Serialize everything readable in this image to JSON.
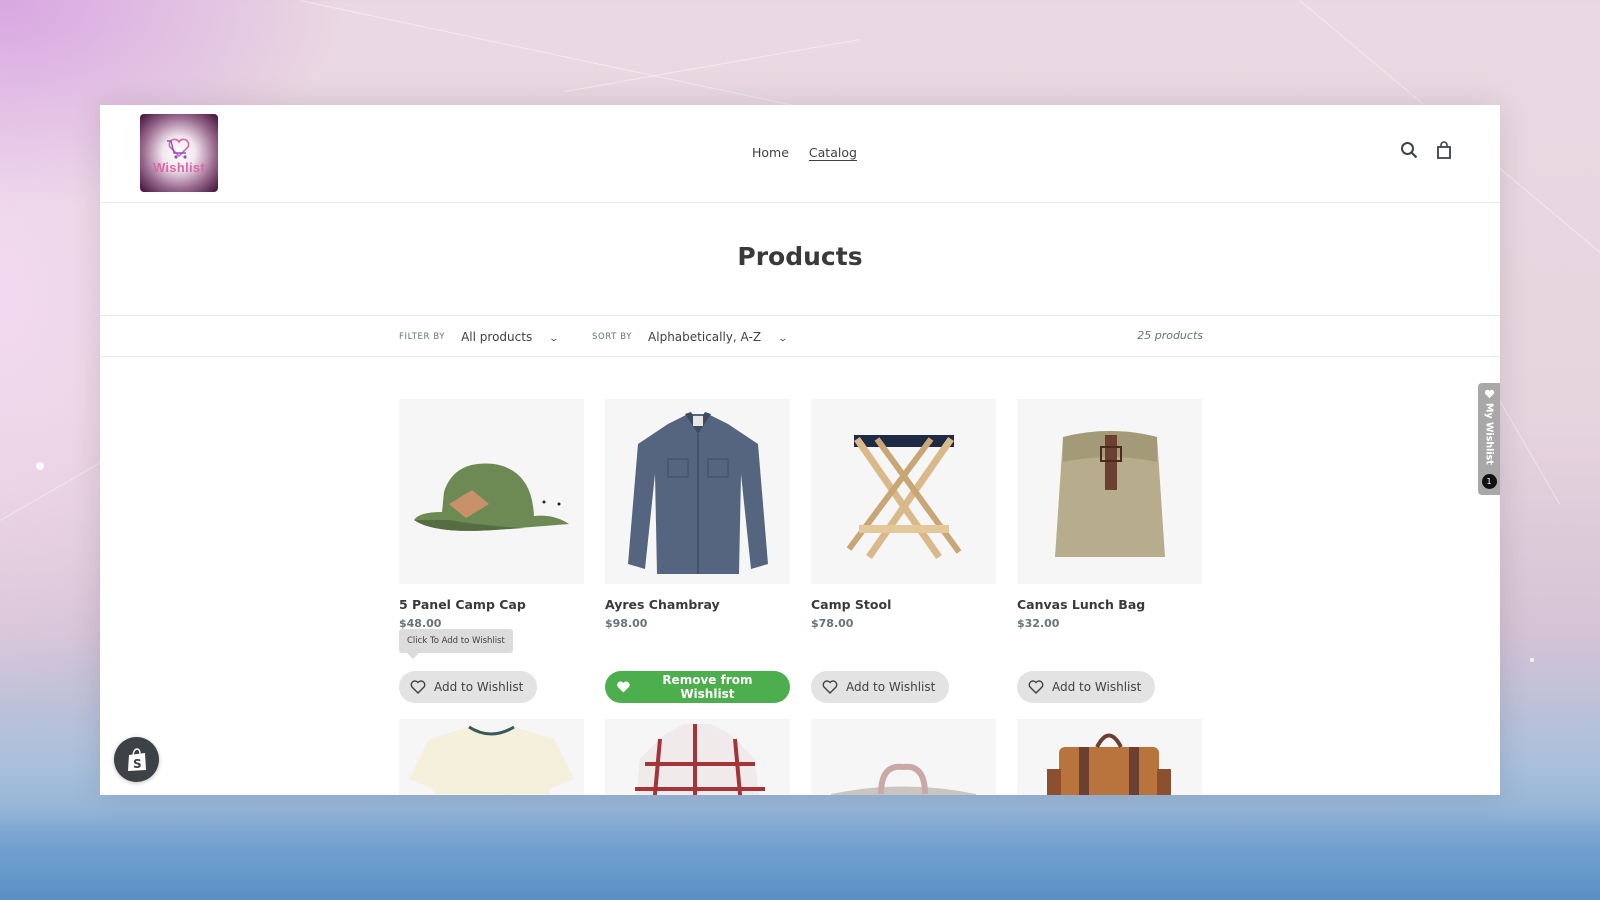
{
  "store": {
    "logo_text": "Wishlist",
    "nav": [
      {
        "label": "Home",
        "active": false
      },
      {
        "label": "Catalog",
        "active": true
      }
    ],
    "icons": {
      "search": "search-icon",
      "cart": "cart-icon"
    }
  },
  "page": {
    "title": "Products"
  },
  "filters": {
    "filter_label": "Filter by",
    "filter_value": "All products",
    "sort_label": "Sort by",
    "sort_value": "Alphabetically, A-Z",
    "count": "25 products"
  },
  "products": [
    {
      "name": "5 Panel Camp Cap",
      "price": "$48.00",
      "wishlist_label": "Add to Wishlist",
      "in_wishlist": false,
      "image": "green cap"
    },
    {
      "name": "Ayres Chambray",
      "price": "$98.00",
      "wishlist_label": "Remove from Wishlist",
      "in_wishlist": true,
      "image": "chambray shirt"
    },
    {
      "name": "Camp Stool",
      "price": "$78.00",
      "wishlist_label": "Add to Wishlist",
      "in_wishlist": false,
      "image": "wooden stool"
    },
    {
      "name": "Canvas Lunch Bag",
      "price": "$32.00",
      "wishlist_label": "Add to Wishlist",
      "in_wishlist": false,
      "image": "canvas bag"
    }
  ],
  "products_row2": [
    {
      "image": "cream t-shirt"
    },
    {
      "image": "plaid shirt"
    },
    {
      "image": "grey duffel bag"
    },
    {
      "image": "leather backpack"
    }
  ],
  "tooltip": "Click To Add to Wishlist",
  "wishlist_tab": {
    "label": "My Wishlist",
    "count": "1"
  },
  "colors": {
    "wishlist_active": "#4cae4c",
    "wishlist_inactive": "#e3e3e3",
    "text": "#3d4246"
  }
}
